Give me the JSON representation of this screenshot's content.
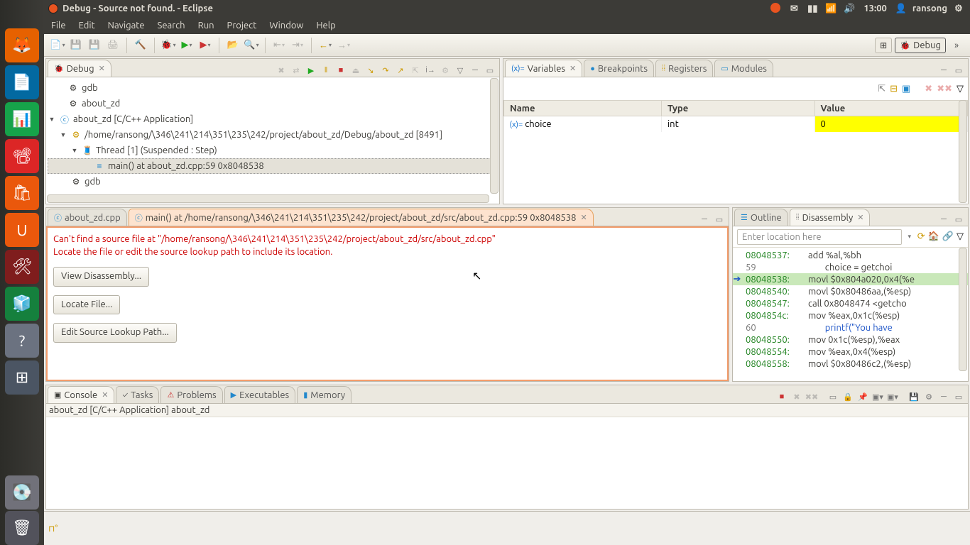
{
  "system": {
    "window_title": "Debug - Source not found. - Eclipse",
    "clock": "13:00",
    "username": "ransong"
  },
  "menubar": [
    "File",
    "Edit",
    "Navigate",
    "Search",
    "Run",
    "Project",
    "Window",
    "Help"
  ],
  "perspectives": {
    "debug": "Debug"
  },
  "debug_view": {
    "title": "Debug",
    "tree": {
      "gdb1": "gdb",
      "aboutzd1": "about_zd",
      "app": "about_zd [C/C++ Application]",
      "proc": "/home/ransong/\\346\\241\\214\\351\\235\\242/project/about_zd/Debug/about_zd [8491]",
      "thread": "Thread [1] (Suspended : Step)",
      "frame": "main() at about_zd.cpp:59 0x8048538",
      "gdb2": "gdb"
    }
  },
  "vars_view": {
    "tabs": {
      "vars": "Variables",
      "bp": "Breakpoints",
      "reg": "Registers",
      "mod": "Modules"
    },
    "headers": {
      "name": "Name",
      "type": "Type",
      "value": "Value"
    },
    "rows": [
      {
        "name": "choice",
        "type": "int",
        "value": "0"
      }
    ]
  },
  "editor": {
    "tab1": "about_zd.cpp",
    "tab2": "main() at /home/ransong/\\346\\241\\214\\351\\235\\242/project/about_zd/src/about_zd.cpp:59 0x8048538",
    "err1": "Can't find a source file at \"/home/ransong/\\346\\241\\214\\351\\235\\242/project/about_zd/src/about_zd.cpp\"",
    "err2": "Locate the file or edit the source lookup path to include its location.",
    "btn_disasm": "View Disassembly...",
    "btn_locate": "Locate File...",
    "btn_lookup": "Edit Source Lookup Path..."
  },
  "outline": {
    "tab_outline": "Outline",
    "tab_disasm": "Disassembly",
    "loc_placeholder": "Enter location here",
    "lines": [
      {
        "mark": "",
        "addr": "08048537:",
        "instr": "add %al,%bh",
        "cls": ""
      },
      {
        "mark": "",
        "addr": "59",
        "instr": "        choice = getchoi",
        "cls": "src"
      },
      {
        "mark": "➔",
        "addr": "08048538:",
        "instr": "movl $0x804a020,0x4(%e",
        "cls": "cur"
      },
      {
        "mark": "",
        "addr": "08048540:",
        "instr": "movl $0x80486aa,(%esp)",
        "cls": ""
      },
      {
        "mark": "",
        "addr": "08048547:",
        "instr": "call 0x8048474 <getcho",
        "cls": ""
      },
      {
        "mark": "",
        "addr": "0804854c:",
        "instr": "mov %eax,0x1c(%esp)",
        "cls": ""
      },
      {
        "mark": "",
        "addr": "60",
        "instr": "        printf(\"You have",
        "cls": "src str"
      },
      {
        "mark": "",
        "addr": "08048550:",
        "instr": "mov 0x1c(%esp),%eax",
        "cls": ""
      },
      {
        "mark": "",
        "addr": "08048554:",
        "instr": "mov %eax,0x4(%esp)",
        "cls": ""
      },
      {
        "mark": "",
        "addr": "08048558:",
        "instr": "movl $0x80486c2,(%esp)",
        "cls": ""
      }
    ]
  },
  "console": {
    "tabs": {
      "console": "Console",
      "tasks": "Tasks",
      "problems": "Problems",
      "exec": "Executables",
      "mem": "Memory"
    },
    "title": "about_zd [C/C++ Application] about_zd"
  }
}
